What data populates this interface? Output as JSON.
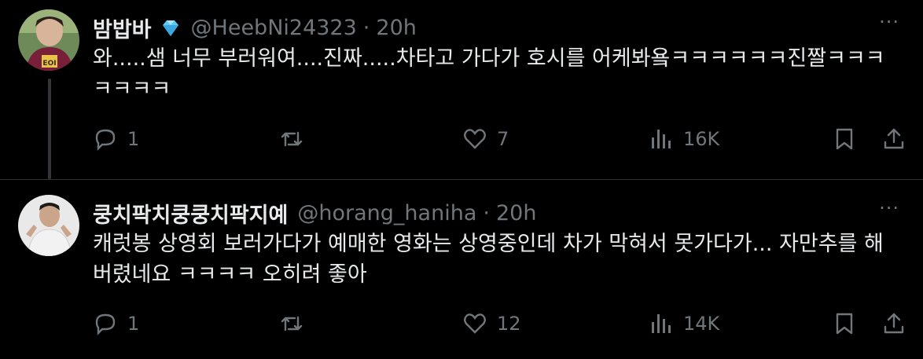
{
  "tweets": [
    {
      "display_name": "밤밥바",
      "handle": "@HeebNi24323",
      "separator": "·",
      "time": "20h",
      "more_label": "···",
      "text": "와.....샘 너무 부러워여....진짜.....차타고 가다가 호시를 어케봐욬ㅋㅋㅋㅋㅋㅋ진짤ㅋㅋㅋ\nㅋㅋㅋㅋ",
      "verified_icon": "diamond-icon",
      "stats": {
        "replies": "1",
        "reposts": "",
        "likes": "7",
        "views": "16K"
      }
    },
    {
      "display_name": "쿵치팍치쿵쿵치팍지예",
      "handle": "@horang_haniha",
      "separator": "·",
      "time": "20h",
      "more_label": "···",
      "text": "캐럿봉 상영회 보러가다가 예매한 영화는 상영중인데 차가 막혀서 못가다가... 자만추를 해\n버렸네요 ㅋㅋㅋㅋ 오히려 좋아",
      "stats": {
        "replies": "1",
        "reposts": "",
        "likes": "12",
        "views": "14K"
      }
    }
  ],
  "colors": {
    "background": "#000000",
    "text": "#e7e9ea",
    "muted": "#71767b",
    "thread_line": "#333639",
    "verified": "#5fc8f7"
  }
}
